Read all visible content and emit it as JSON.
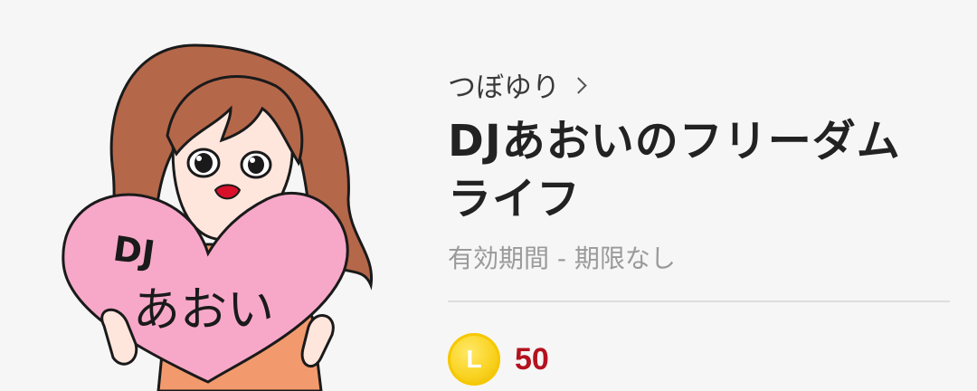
{
  "sticker": {
    "heart_text_line1": "DJ",
    "heart_text_line2": "あおい"
  },
  "author": {
    "name": "つぼゆり"
  },
  "product": {
    "title": "DJあおいのフリーダムライフ",
    "validity": "有効期間 - 期限なし"
  },
  "price": {
    "coin_letter": "L",
    "amount": "50"
  },
  "colors": {
    "background": "#f6f6f6",
    "price_red": "#b4121e",
    "coin_yellow": "#f9d21f",
    "heart_pink": "#f7a8c8",
    "hair_brown": "#b5674a"
  }
}
